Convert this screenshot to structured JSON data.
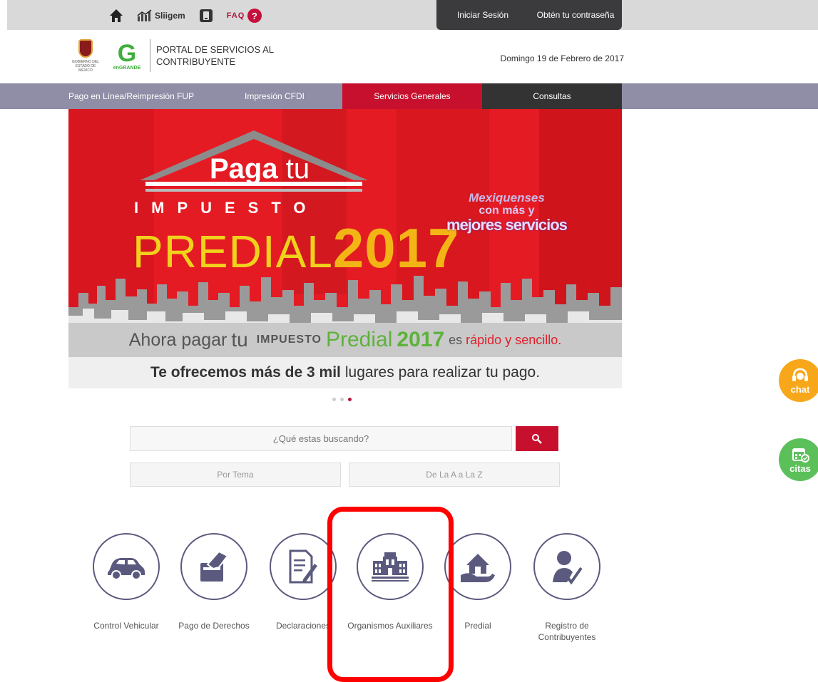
{
  "topbar": {
    "sliigem_label": "Sliigem",
    "faq_label": "FAQ",
    "faq_mark": "?",
    "login_label": "Iniciar Sesión",
    "password_label": "Obtén tu contraseña"
  },
  "header": {
    "gov_logo_text": "GOBIERNO DEL ESTADO DE MÉXICO",
    "engrande_letter": "G",
    "engrande_text": "enGRANDE",
    "portal_title": "PORTAL DE SERVICIOS AL CONTRIBUYENTE",
    "date": "Domingo 19 de Febrero de 2017"
  },
  "nav": {
    "items": [
      {
        "label": "Pago en Línea/Reimpresión FUP"
      },
      {
        "label": "Impresión CFDI"
      },
      {
        "label": "Servicios Generales"
      },
      {
        "label": "Consultas"
      }
    ]
  },
  "banner": {
    "paga": "Paga",
    "tu": "tu",
    "impuesto": "IMPUESTO",
    "predial": "PREDIAL",
    "year": "2017",
    "slogan_1": "Mexiquenses",
    "slogan_2": "con más y",
    "slogan_3": "mejores servicios",
    "line1_a": "Ahora pagar",
    "line1_b": "tu",
    "line1_c": "IMPUESTO",
    "line1_d": "Predial",
    "line1_e": "2017",
    "line1_f": "es",
    "line1_g": "rápido y sencillo.",
    "line2_bold": "Te ofrecemos más de 3 mil",
    "line2_rest": "lugares para realizar tu pago."
  },
  "search": {
    "placeholder": "¿Qué estas buscando?",
    "by_topic": "Por Tema",
    "a_to_z": "De La A a La Z"
  },
  "services": [
    {
      "label": "Control Vehicular"
    },
    {
      "label": "Pago de Derechos"
    },
    {
      "label": "Declaraciones"
    },
    {
      "label": "Organismos Auxiliares"
    },
    {
      "label": "Predial"
    },
    {
      "label": "Registro de Contribuyentes"
    }
  ],
  "floating": {
    "chat": "chat",
    "citas": "citas"
  },
  "colors": {
    "accent_red": "#c7102e",
    "nav_gray": "#8f8ea6",
    "highlight": "#ff0000"
  }
}
